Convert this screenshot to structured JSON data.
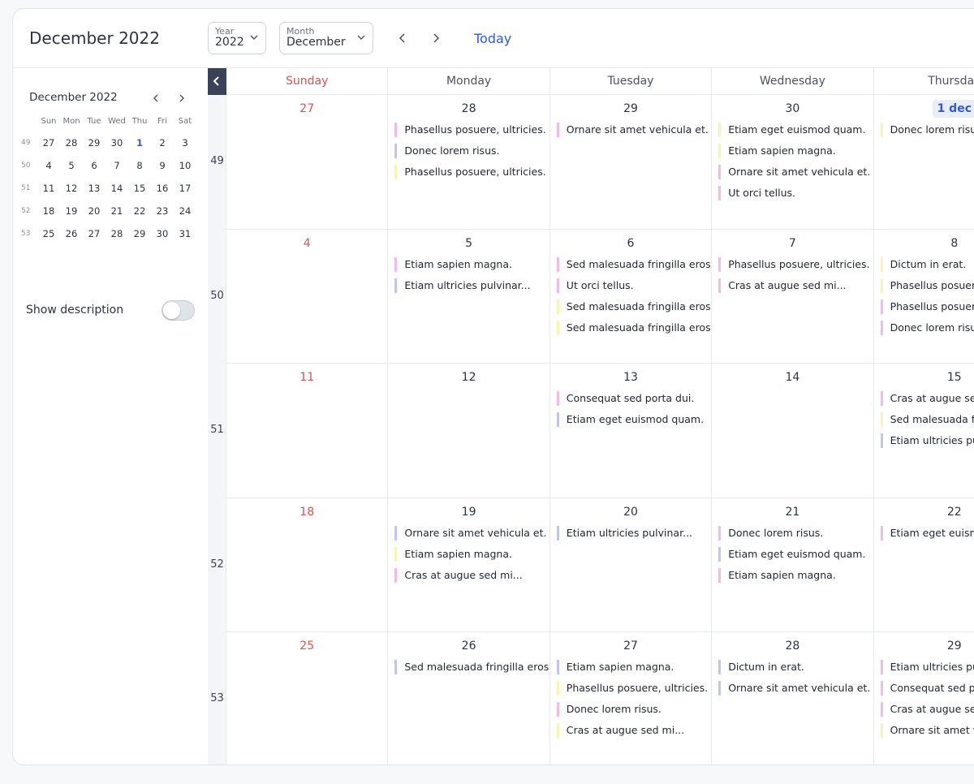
{
  "header": {
    "title": "December 2022",
    "year_label": "Year",
    "year_value": "2022",
    "month_label": "Month",
    "month_value": "December",
    "today_label": "Today"
  },
  "sidebar": {
    "mini_title": "December 2022",
    "weekdays": [
      "Sun",
      "Mon",
      "Tue",
      "Wed",
      "Thu",
      "Fri",
      "Sat"
    ],
    "weeks": [
      {
        "wk": "49",
        "days": [
          "27",
          "28",
          "29",
          "30",
          "1",
          "2",
          "3"
        ]
      },
      {
        "wk": "50",
        "days": [
          "4",
          "5",
          "6",
          "7",
          "8",
          "9",
          "10"
        ]
      },
      {
        "wk": "51",
        "days": [
          "11",
          "12",
          "13",
          "14",
          "15",
          "16",
          "17"
        ]
      },
      {
        "wk": "52",
        "days": [
          "18",
          "19",
          "20",
          "21",
          "22",
          "23",
          "24"
        ]
      },
      {
        "wk": "53",
        "days": [
          "25",
          "26",
          "27",
          "28",
          "29",
          "30",
          "31"
        ]
      }
    ],
    "show_description_label": "Show description"
  },
  "calendar": {
    "days_of_week": [
      "Sunday",
      "Monday",
      "Tuesday",
      "Wednesday",
      "Thursday"
    ],
    "weeks": [
      {
        "wk": "49",
        "cells": [
          {
            "day": "27",
            "events": []
          },
          {
            "day": "28",
            "events": [
              {
                "t": "Phasellus posuere, ultricies.",
                "c": "pink"
              },
              {
                "t": "Donec lorem risus.",
                "c": "purple"
              },
              {
                "t": "Phasellus posuere, ultricies.",
                "c": "yellow"
              }
            ]
          },
          {
            "day": "29",
            "events": [
              {
                "t": "Ornare sit amet vehicula et.",
                "c": "pink"
              }
            ]
          },
          {
            "day": "30",
            "events": [
              {
                "t": "Etiam eget euismod quam.",
                "c": "yellow"
              },
              {
                "t": "Etiam sapien magna.",
                "c": "yellow"
              },
              {
                "t": "Ornare sit amet vehicula et.",
                "c": "pink"
              },
              {
                "t": "Ut orci tellus.",
                "c": "pink"
              }
            ]
          },
          {
            "day": "1 dec",
            "current": true,
            "events": [
              {
                "t": "Donec lorem risus.",
                "c": "yellow"
              }
            ]
          }
        ]
      },
      {
        "wk": "50",
        "cells": [
          {
            "day": "4",
            "events": []
          },
          {
            "day": "5",
            "events": [
              {
                "t": "Etiam sapien magna.",
                "c": "pink"
              },
              {
                "t": "Etiam ultricies pulvinar...",
                "c": "purple"
              }
            ]
          },
          {
            "day": "6",
            "events": [
              {
                "t": "Sed malesuada fringilla eros.",
                "c": "pink"
              },
              {
                "t": "Ut orci tellus.",
                "c": "pink"
              },
              {
                "t": "Sed malesuada fringilla eros.",
                "c": "yellow"
              },
              {
                "t": "Sed malesuada fringilla eros.",
                "c": "yellow"
              }
            ]
          },
          {
            "day": "7",
            "events": [
              {
                "t": "Phasellus posuere, ultricies.",
                "c": "pink"
              },
              {
                "t": "Cras at augue sed mi...",
                "c": "pink"
              }
            ]
          },
          {
            "day": "8",
            "events": [
              {
                "t": "Dictum in erat.",
                "c": "yellow"
              },
              {
                "t": "Phasellus posuere",
                "c": "yellow"
              },
              {
                "t": "Phasellus posuere",
                "c": "pink"
              },
              {
                "t": "Donec lorem risus",
                "c": "pink"
              }
            ]
          }
        ]
      },
      {
        "wk": "51",
        "cells": [
          {
            "day": "11",
            "events": []
          },
          {
            "day": "12",
            "events": []
          },
          {
            "day": "13",
            "events": [
              {
                "t": "Consequat sed porta dui.",
                "c": "pink"
              },
              {
                "t": "Etiam eget euismod quam.",
                "c": "purple"
              }
            ]
          },
          {
            "day": "14",
            "events": []
          },
          {
            "day": "15",
            "events": [
              {
                "t": "Cras at augue sed",
                "c": "pink"
              },
              {
                "t": "Sed malesuada fri",
                "c": "yellow"
              },
              {
                "t": "Etiam ultricies pul",
                "c": "purple"
              }
            ]
          }
        ]
      },
      {
        "wk": "52",
        "cells": [
          {
            "day": "18",
            "events": []
          },
          {
            "day": "19",
            "events": [
              {
                "t": "Ornare sit amet vehicula et.",
                "c": "purple"
              },
              {
                "t": "Etiam sapien magna.",
                "c": "yellow"
              },
              {
                "t": "Cras at augue sed mi...",
                "c": "pink"
              }
            ]
          },
          {
            "day": "20",
            "events": [
              {
                "t": "Etiam ultricies pulvinar...",
                "c": "purple"
              }
            ]
          },
          {
            "day": "21",
            "events": [
              {
                "t": "Donec lorem risus.",
                "c": "pink"
              },
              {
                "t": "Etiam eget euismod quam.",
                "c": "purple"
              },
              {
                "t": "Etiam sapien magna.",
                "c": "pink"
              }
            ]
          },
          {
            "day": "22",
            "events": [
              {
                "t": "Etiam eget euismo",
                "c": "pink"
              }
            ]
          }
        ]
      },
      {
        "wk": "53",
        "cells": [
          {
            "day": "25",
            "events": []
          },
          {
            "day": "26",
            "events": [
              {
                "t": "Sed malesuada fringilla eros.",
                "c": "purple"
              }
            ]
          },
          {
            "day": "27",
            "events": [
              {
                "t": "Etiam sapien magna.",
                "c": "purple"
              },
              {
                "t": "Phasellus posuere, ultricies.",
                "c": "yellow"
              },
              {
                "t": "Donec lorem risus.",
                "c": "pink"
              },
              {
                "t": "Cras at augue sed mi...",
                "c": "yellow"
              }
            ]
          },
          {
            "day": "28",
            "events": [
              {
                "t": "Dictum in erat.",
                "c": "purple"
              },
              {
                "t": "Ornare sit amet vehicula et.",
                "c": "purple"
              }
            ]
          },
          {
            "day": "29",
            "events": [
              {
                "t": "Etiam ultricies pul",
                "c": "pink"
              },
              {
                "t": "Consequat sed po",
                "c": "pink"
              },
              {
                "t": "Cras at augue sed",
                "c": "pink"
              },
              {
                "t": "Ornare sit amet ve",
                "c": "yellow"
              }
            ]
          }
        ]
      }
    ]
  },
  "colors": {
    "accent": "#2f5bd3",
    "sunday": "#d9534f",
    "pink": "#f5b8ee",
    "purple": "#c1c3f5",
    "yellow": "#fbf3b3"
  }
}
